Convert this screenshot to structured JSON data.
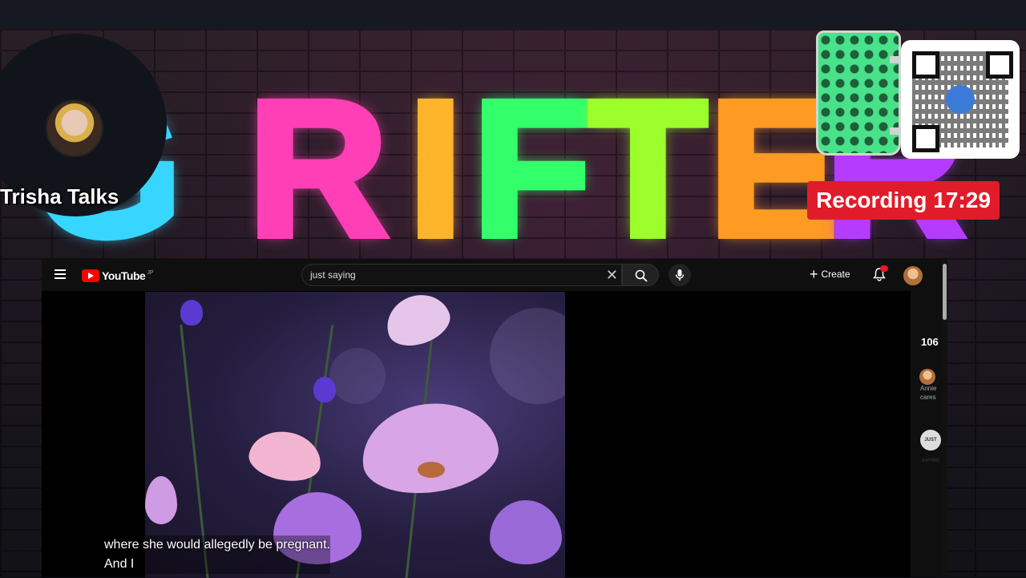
{
  "overlay": {
    "streamer_name": "Trisha Talks",
    "neon_sign": [
      "G",
      "R",
      "I",
      "F",
      "T",
      "E",
      "R"
    ],
    "recording_label": "Recording 17:29",
    "colors": {
      "recording_bg": "#e11c2a",
      "neon": [
        "#37d6ff",
        "#ff3fb5",
        "#ff3fb5",
        "#ffb52b",
        "#33ff6b",
        "#9cff2b",
        "#ff9a22",
        "#b53cff"
      ]
    }
  },
  "youtube": {
    "logo_text": "YouTube",
    "logo_sup": "JP",
    "search": {
      "value": "just saying"
    },
    "create_label": "Create",
    "icons": [
      "menu-icon",
      "youtube-logo-icon",
      "close-icon",
      "search-icon",
      "mic-icon",
      "plus-icon",
      "bell-icon",
      "avatar"
    ]
  },
  "video": {
    "caption_lines": [
      "where she would allegedly be pregnant.",
      "And I"
    ]
  },
  "sidebar": {
    "count": "106",
    "channel_text_1": "Annie",
    "channel_text_2": "cares",
    "badge_text": "JUST SAYING"
  }
}
